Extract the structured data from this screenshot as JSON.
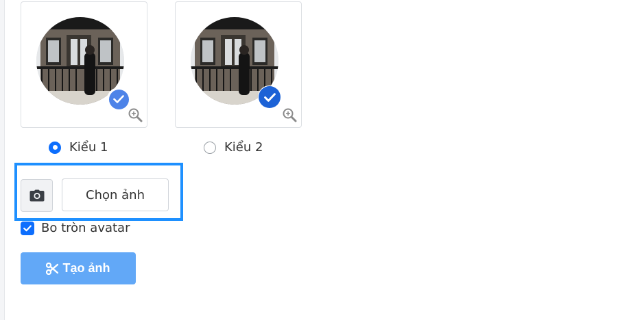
{
  "styles": [
    {
      "label": "Kiểu 1",
      "selected": true
    },
    {
      "label": "Kiểu 2",
      "selected": false
    }
  ],
  "upload": {
    "choose_label": "Chọn ảnh",
    "camera_icon": "camera-icon"
  },
  "options": {
    "round_avatar_label": "Bo tròn avatar",
    "round_avatar_checked": true
  },
  "actions": {
    "create_label": "Tạo ảnh",
    "create_icon": "scissors-icon"
  },
  "colors": {
    "primary": "#0d6efd",
    "highlight": "#1e90ff",
    "create_button": "#62a8f7",
    "badge_style1": "#4d83e8",
    "badge_style2": "#1c62d6"
  }
}
